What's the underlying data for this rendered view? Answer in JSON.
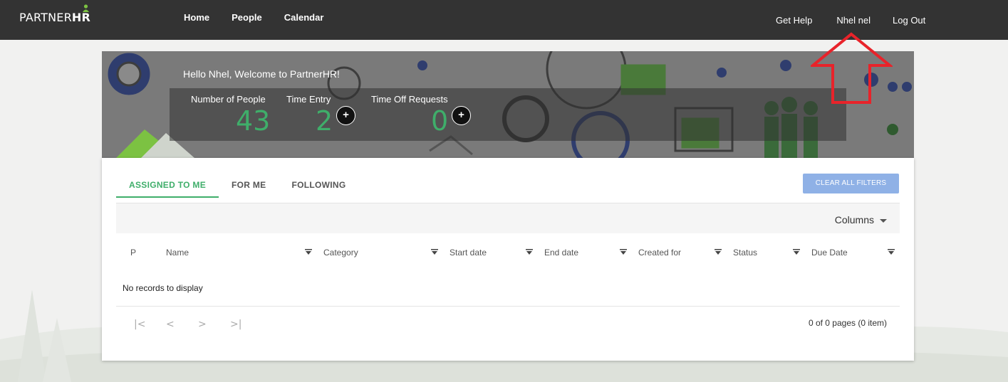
{
  "app": {
    "logo_partner": "PARTNER",
    "logo_hr": "HR",
    "brand_color": "#3fae6a"
  },
  "nav": {
    "left": [
      "Home",
      "People",
      "Calendar"
    ],
    "right": [
      "Get Help",
      "Nhel nel",
      "Log Out"
    ]
  },
  "banner": {
    "welcome": "Hello Nhel, Welcome to PartnerHR!",
    "stats": [
      {
        "label": "Number of People",
        "value": "43"
      },
      {
        "label": "Time Entry",
        "value": "2",
        "add": "+"
      },
      {
        "label": "Time Off Requests",
        "value": "0",
        "add": "+"
      }
    ]
  },
  "annotation": {
    "arrow_color": "#e8232a",
    "points_to": "Nhel nel"
  },
  "tabs": [
    "ASSIGNED TO ME",
    "FOR ME",
    "FOLLOWING"
  ],
  "active_tab": "ASSIGNED TO ME",
  "clear_filters": "CLEAR ALL FILTERS",
  "columns_label": "Columns",
  "table": {
    "headers": [
      "P",
      "Name",
      "Category",
      "Start date",
      "End date",
      "Created for",
      "Status",
      "Due Date"
    ],
    "empty_message": "No records to display"
  },
  "pager": {
    "buttons": [
      "first-page-icon",
      "prev-page-icon",
      "next-page-icon",
      "last-page-icon"
    ],
    "glyphs": [
      "|<",
      "<",
      ">",
      ">|"
    ],
    "info": "0 of 0 pages (0 item)"
  }
}
